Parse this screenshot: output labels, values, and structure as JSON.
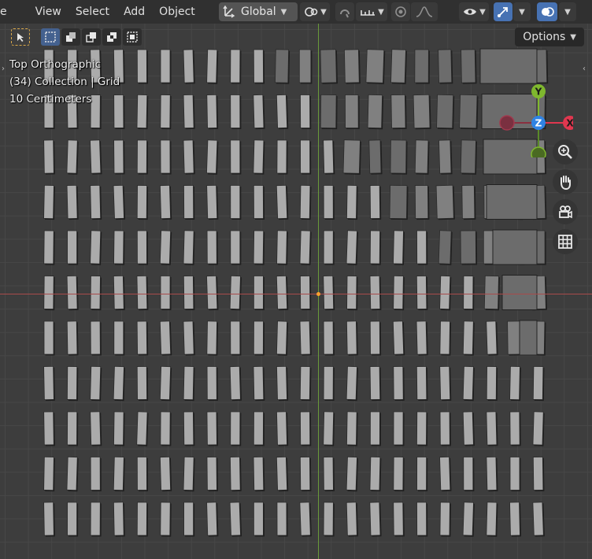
{
  "header": {
    "menus": [
      "View",
      "Select",
      "Add",
      "Object"
    ],
    "left_glyph": "e",
    "transform_orientation": "Global",
    "pivot_icon": "pivot-point-icon",
    "snap_icon": "snap-magnet-icon",
    "proportional_icon": "proportional-edit-icon"
  },
  "toolbar": {
    "options_label": "Options"
  },
  "overlay": {
    "view_name": "Top Orthographic",
    "collection": "(34) Collection | Grid",
    "scale": "10 Centimeters"
  },
  "gizmo": {
    "y_label": "Y",
    "z_label": "Z",
    "x_label": "X",
    "x_color": "#e0374f",
    "y_color": "#7fb82e",
    "z_color": "#2f83e4"
  },
  "colors": {
    "tile_light": "#ababab",
    "tile_dark": "#6c6c6c",
    "accent": "#4772b3"
  }
}
